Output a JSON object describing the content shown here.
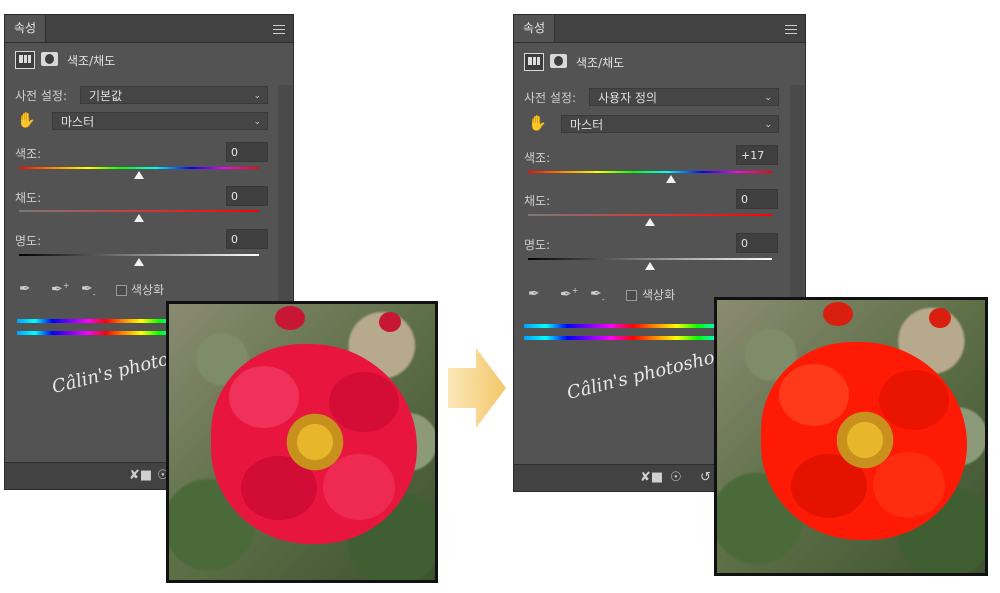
{
  "left_panel": {
    "tab_label": "속성",
    "header_title": "색조/채도",
    "preset_label": "사전 설정:",
    "preset_value": "기본값",
    "channel_value": "마스터",
    "hue_label": "색조:",
    "hue_value": "0",
    "saturation_label": "채도:",
    "saturation_value": "0",
    "lightness_label": "명도:",
    "lightness_value": "0",
    "colorize_label": "색상화"
  },
  "right_panel": {
    "tab_label": "속성",
    "header_title": "색조/채도",
    "preset_label": "사전 설정:",
    "preset_value": "사용자 정의",
    "channel_value": "마스터",
    "hue_label": "색조:",
    "hue_value": "+17",
    "saturation_label": "채도:",
    "saturation_value": "0",
    "lightness_label": "명도:",
    "lightness_value": "0",
    "colorize_label": "색상화"
  },
  "watermark": "Câlin's photoshop tutorial",
  "colors": {
    "panel_bg": "#535353",
    "rose_before": "#e8163f",
    "rose_after": "#ff1a06",
    "arrow": "#f6d48a"
  },
  "icons": [
    "panel-menu-icon",
    "adjustment-layer-icon",
    "mask-icon",
    "targeted-adjustment-hand-icon",
    "eyedropper-icon",
    "eyedropper-add-icon",
    "eyedropper-subtract-icon",
    "clip-to-layer-icon",
    "visibility-icon",
    "reset-icon",
    "right-arrow-icon"
  ]
}
